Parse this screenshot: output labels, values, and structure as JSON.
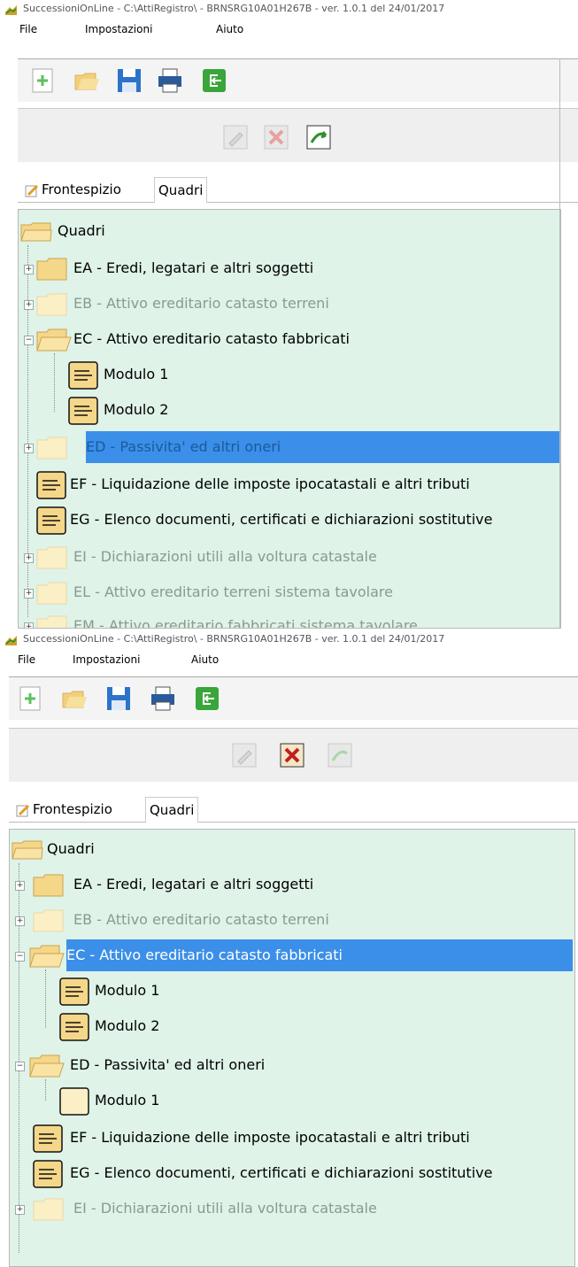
{
  "window": {
    "title": "SuccessioniOnLine - C:\\AttiRegistro\\ - BRNSRG10A01H267B  -  ver. 1.0.1 del 24/01/2017"
  },
  "menu": {
    "file": "File",
    "settings": "Impostazioni",
    "help": "Aiuto"
  },
  "toolbar": {
    "icons": [
      "new-document-icon",
      "open-folder-icon",
      "save-icon",
      "print-icon",
      "exit-icon"
    ]
  },
  "edit_toolbar": {
    "icons": [
      "edit-icon",
      "delete-icon",
      "export-icon"
    ]
  },
  "tabs": {
    "frontespizio": "Frontespizio",
    "quadri": "Quadri"
  },
  "panel1": {
    "tree": {
      "root": "Quadri",
      "nodes": [
        {
          "label": "EA - Eredi, legatari e altri soggetti"
        },
        {
          "label": "EB - Attivo ereditario catasto terreni"
        },
        {
          "label": "EC - Attivo ereditario catasto fabbricati"
        },
        {
          "label": "Modulo 1"
        },
        {
          "label": "Modulo 2"
        },
        {
          "label": "ED - Passivita' ed altri oneri"
        },
        {
          "label": "EF - Liquidazione delle imposte ipocatastali e altri tributi"
        },
        {
          "label": "EG - Elenco documenti, certificati e dichiarazioni sostitutive"
        },
        {
          "label": "EI - Dichiarazioni utili alla voltura catastale"
        },
        {
          "label": "EL - Attivo ereditario terreni sistema tavolare"
        },
        {
          "label": "EM - Attivo ereditario fabbricati sistema tavolare"
        }
      ]
    }
  },
  "panel2": {
    "tree": {
      "root": "Quadri",
      "nodes": [
        {
          "label": "EA - Eredi, legatari e altri soggetti"
        },
        {
          "label": "EB - Attivo ereditario catasto terreni"
        },
        {
          "label": "EC - Attivo ereditario catasto fabbricati"
        },
        {
          "label": "Modulo 1"
        },
        {
          "label": "Modulo 2"
        },
        {
          "label": "ED - Passivita' ed altri oneri"
        },
        {
          "label": "Modulo 1"
        },
        {
          "label": "EF - Liquidazione delle imposte ipocatastali e altri tributi"
        },
        {
          "label": "EG - Elenco documenti, certificati e dichiarazioni sostitutive"
        },
        {
          "label": "EI - Dichiarazioni utili alla voltura catastale"
        }
      ]
    }
  },
  "colors": {
    "tree_bg": "#dff3e8",
    "selection": "#3b8fe8",
    "folder": "#f5d78a",
    "disabled_text": "#8a9a8f"
  }
}
